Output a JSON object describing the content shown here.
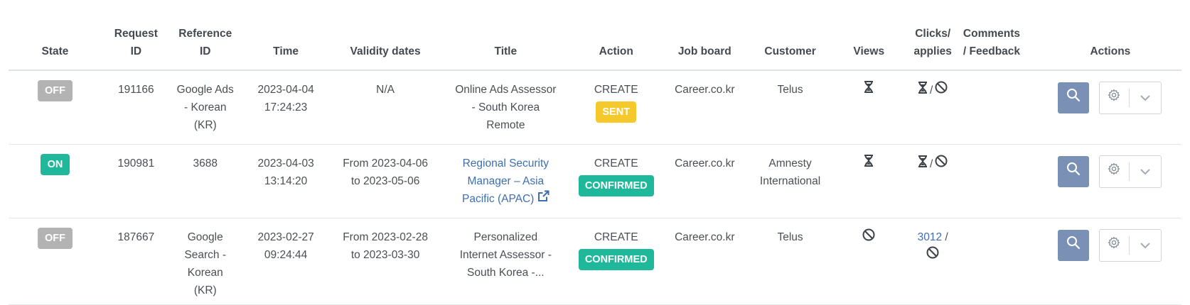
{
  "headers": {
    "state": "State",
    "request_id_1": "Request",
    "request_id_2": "ID",
    "reference_id_1": "Reference",
    "reference_id_2": "ID",
    "time": "Time",
    "validity": "Validity dates",
    "title": "Title",
    "action": "Action",
    "job_board": "Job board",
    "customer": "Customer",
    "views": "Views",
    "clicks_1": "Clicks/",
    "clicks_2": "applies",
    "comments_1": "Comments",
    "comments_2": "/ Feedback",
    "actions": "Actions"
  },
  "rows": [
    {
      "state": "OFF",
      "request_id": "191166",
      "reference": [
        "Google Ads",
        "- Korean",
        "(KR)"
      ],
      "time": [
        "2023-04-04",
        "17:24:23"
      ],
      "validity": [
        "N/A"
      ],
      "title": [
        "Online Ads Assessor",
        "- South Korea",
        "Remote"
      ],
      "action": "CREATE",
      "action_status": "SENT",
      "job_board": "Career.co.kr",
      "customer": [
        "Telus"
      ],
      "views_icon": "hourglass-icon",
      "clicks_icon": "hourglass-icon",
      "applies_icon": "ban-icon"
    },
    {
      "state": "ON",
      "request_id": "190981",
      "reference": [
        "3688"
      ],
      "time": [
        "2023-04-03",
        "13:14:20"
      ],
      "validity": [
        "From 2023-04-06",
        "to 2023-05-06"
      ],
      "title": [
        "Regional Security",
        "Manager – Asia",
        "Pacific (APAC)"
      ],
      "title_link_icon": "external-link-icon",
      "action": "CREATE",
      "action_status": "CONFIRMED",
      "job_board": "Career.co.kr",
      "customer": [
        "Amnesty",
        "International"
      ],
      "views_icon": "hourglass-icon",
      "clicks_icon": "hourglass-icon",
      "applies_icon": "ban-icon"
    },
    {
      "state": "OFF",
      "request_id": "187667",
      "reference": [
        "Google",
        "Search -",
        "Korean",
        "(KR)"
      ],
      "time": [
        "2023-02-27",
        "09:24:44"
      ],
      "validity": [
        "From 2023-02-28",
        "to 2023-03-30"
      ],
      "title": [
        "Personalized",
        "Internet Assessor -",
        "South Korea -..."
      ],
      "action": "CREATE",
      "action_status": "CONFIRMED",
      "job_board": "Career.co.kr",
      "customer": [
        "Telus"
      ],
      "views_icon": "ban-icon",
      "clicks": "3012",
      "applies_icon": "ban-icon"
    }
  ],
  "colors": {
    "state_off": "#b3b3b3",
    "state_on": "#1fb89a",
    "sent": "#f5c92b",
    "confirmed": "#1fb89a",
    "link": "#3d6fb0",
    "search_button": "#7a91b5"
  }
}
